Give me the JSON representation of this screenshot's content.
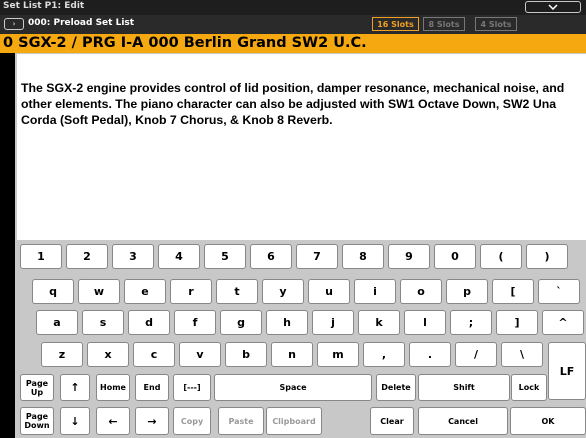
{
  "titlebar": {
    "title": "Set List P1: Edit",
    "menu_icon": "chevron-down"
  },
  "setlist": {
    "icon_label": "›",
    "name": "000: Preload Set List"
  },
  "slots": [
    {
      "label": "16 Slots",
      "active": true
    },
    {
      "label": "8 Slots",
      "active": false
    },
    {
      "label": "4 Slots",
      "active": false
    }
  ],
  "program": {
    "label": "0 SGX-2 / PRG I-A 000 Berlin Grand SW2 U.C."
  },
  "text": {
    "body": "The SGX-2 engine provides control of lid position, damper resonance, mechanical noise, and other elements.  The piano character can also be adjusted with SW1 Octave Down, SW2 Una Corda (Soft Pedal), Knob 7 Chorus, & Knob 8 Reverb."
  },
  "keyboard": {
    "row1": [
      "1",
      "2",
      "3",
      "4",
      "5",
      "6",
      "7",
      "8",
      "9",
      "0",
      "(",
      ")"
    ],
    "row2": [
      "q",
      "w",
      "e",
      "r",
      "t",
      "y",
      "u",
      "i",
      "o",
      "p",
      "[",
      "`"
    ],
    "row3": [
      "a",
      "s",
      "d",
      "f",
      "g",
      "h",
      "j",
      "k",
      "l",
      ";",
      "]",
      "^"
    ],
    "row4": [
      "z",
      "x",
      "c",
      "v",
      "b",
      "n",
      "m",
      ",",
      ".",
      "/",
      "\\"
    ],
    "lf": "LF",
    "row5": {
      "page_up": "Page Up",
      "up": "↑",
      "home": "Home",
      "end": "End",
      "bracket": "[---]",
      "space": "Space",
      "delete": "Delete",
      "shift": "Shift",
      "lock": "Lock"
    },
    "row6": {
      "page_down": "Page Down",
      "down": "↓",
      "left": "←",
      "right": "→",
      "copy": "Copy",
      "paste": "Paste",
      "clipboard": "Clipboard",
      "clear": "Clear",
      "cancel": "Cancel",
      "ok": "OK"
    }
  }
}
